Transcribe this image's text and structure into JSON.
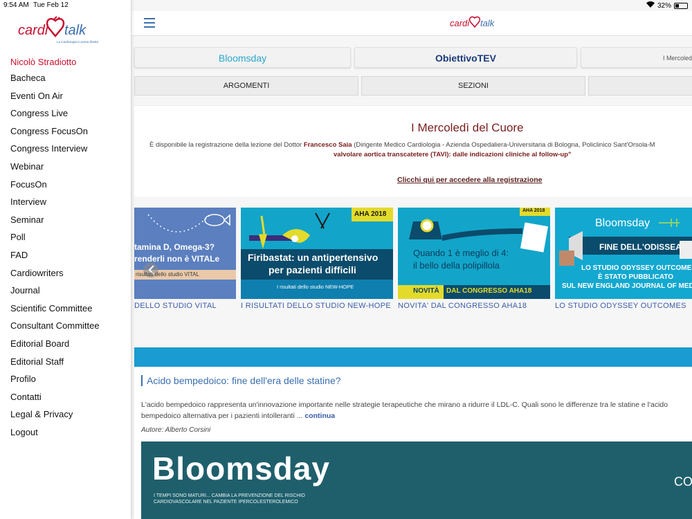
{
  "status": {
    "time": "9:54 AM",
    "date": "Tue Feb 12",
    "battery": "32%"
  },
  "sidebar": {
    "user": "Nicolò Stradiotto",
    "items": [
      "Bacheca",
      "Eventi On Air",
      "Congress Live",
      "Congress FocusOn",
      "Congress Interview",
      "Webinar",
      "FocusOn",
      "Interview",
      "Seminar",
      "Poll",
      "FAD",
      "Cardiowriters",
      "Journal",
      "Scientific Committee",
      "Consultant Committee",
      "Editorial Board",
      "Editorial Staff",
      "Profilo",
      "Contatti",
      "Legal & Privacy",
      "Logout"
    ]
  },
  "partners": {
    "p1": "Bloomsday",
    "p2": "ObiettivoTEV",
    "p3": "I Mercoledì"
  },
  "tabs": {
    "t1": "ARGOMENTI",
    "t2": "SEZIONI",
    "t3": "C"
  },
  "banner": {
    "title": "I Mercoledì del Cuore",
    "line1_pre": "È disponibile la registrazione della lezione del Dottor ",
    "line1_name": "Francesco Saia",
    "line1_post": " (Dirigente Medico Cardiologia - Azienda Ospedaliera-Universitaria di Bologna, Policlinico Sant'Orsola-M",
    "line2": "valvolare aortica transcatetere (TAVI): dalle indicazioni cliniche al follow-up\"",
    "cta": "Clicchi qui per accedere alla registrazione"
  },
  "cards": [
    {
      "caption": "DELLO STUDIO VITAL",
      "img_line1": "tamina D, Omega-3?",
      "img_line2": "renderli non è VITALe",
      "img_strip": "risultati dello studio VITAL"
    },
    {
      "caption": "I RISULTATI DELLO STUDIO NEW-HOPE",
      "img_badge": "AHA 2018",
      "img_line1": "Firibastat: un antipertensivo",
      "img_line2": "per pazienti difficili",
      "img_strip": "I risultati dello studio NEW-HOPE"
    },
    {
      "caption": "NOVITA' DAL CONGRESSO AHA18",
      "img_badge": "AHA 2018",
      "img_line1": "Quando 1 è meglio di 4:",
      "img_line2": "il bello della polipillola",
      "img_strip_a": "NOVITÀ",
      "img_strip_b": "DAL CONGRESSO AHA18"
    },
    {
      "caption": "LO STUDIO ODYSSEY OUTCOMES",
      "img_logo": "Bloomsday",
      "img_line1": "FINE DELL'ODISSEA",
      "img_line2": "LO STUDIO ODYSSEY OUTCOMES",
      "img_line3": "È STATO PUBBLICATO",
      "img_line4": "SUL NEW ENGLAND JOURNAL OF MEDIC"
    }
  ],
  "article": {
    "title": "Acido bempedoico: fine dell'era delle statine?",
    "excerpt": "L'acido bempedoico rappresenta un'innovazione importante nelle strategie terapeutiche che mirano a ridurre il LDL-C. Quali sono le differenze tra le statine e l'acido bempedoico alternativa per i pazienti intolleranti ...",
    "more": "continua",
    "author": "Autore: Alberto Corsini",
    "hero_title": "Bloomsday",
    "hero_sub": "I tempi sono maturi... cambia la prevenzione del rischio cardiovascolare nel paziente ipercolesterolemico",
    "hero_right": "CO"
  },
  "colors": {
    "accent": "#c8102e",
    "link": "#3a6fb0",
    "strip": "#1a9bd1"
  }
}
